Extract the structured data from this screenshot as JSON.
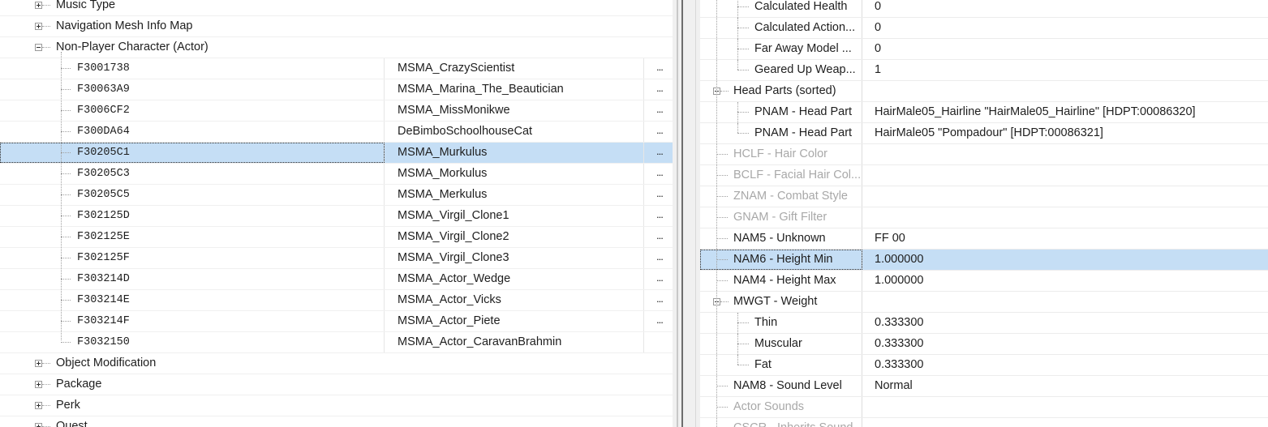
{
  "left_tree": {
    "groups_top": [
      {
        "label": "Music Type",
        "state": "collapsed"
      },
      {
        "label": "Navigation Mesh Info Map",
        "state": "collapsed"
      },
      {
        "label": "Non-Player Character (Actor)",
        "state": "expanded"
      }
    ],
    "npc_rows": [
      {
        "form_id": "F3001738",
        "editor_id": "MSMA_CrazyScientist",
        "more": "..."
      },
      {
        "form_id": "F30063A9",
        "editor_id": "MSMA_Marina_The_Beautician",
        "more": "..."
      },
      {
        "form_id": "F3006CF2",
        "editor_id": "MSMA_MissMonikwe",
        "more": "..."
      },
      {
        "form_id": "F300DA64",
        "editor_id": "DeBimboSchoolhouseCat",
        "more": "..."
      },
      {
        "form_id": "F30205C1",
        "editor_id": "MSMA_Murkulus",
        "more": "...",
        "selected": true
      },
      {
        "form_id": "F30205C3",
        "editor_id": "MSMA_Morkulus",
        "more": "..."
      },
      {
        "form_id": "F30205C5",
        "editor_id": "MSMA_Merkulus",
        "more": "..."
      },
      {
        "form_id": "F302125D",
        "editor_id": "MSMA_Virgil_Clone1",
        "more": "..."
      },
      {
        "form_id": "F302125E",
        "editor_id": "MSMA_Virgil_Clone2",
        "more": "..."
      },
      {
        "form_id": "F302125F",
        "editor_id": "MSMA_Virgil_Clone3",
        "more": "..."
      },
      {
        "form_id": "F303214D",
        "editor_id": "MSMA_Actor_Wedge",
        "more": "..."
      },
      {
        "form_id": "F303214E",
        "editor_id": "MSMA_Actor_Vicks",
        "more": "..."
      },
      {
        "form_id": "F303214F",
        "editor_id": "MSMA_Actor_Piete",
        "more": "..."
      },
      {
        "form_id": "F3032150",
        "editor_id": "MSMA_Actor_CaravanBrahmin",
        "more": ""
      }
    ],
    "groups_bottom": [
      {
        "label": "Object Modification",
        "state": "collapsed"
      },
      {
        "label": "Package",
        "state": "collapsed"
      },
      {
        "label": "Perk",
        "state": "collapsed"
      },
      {
        "label": "Quest",
        "state": "collapsed"
      }
    ]
  },
  "properties": [
    {
      "name": "Calculated Health",
      "value": "0",
      "level": 2
    },
    {
      "name": "Calculated Action...",
      "value": "0",
      "level": 2
    },
    {
      "name": "Far Away Model ...",
      "value": "0",
      "level": 2
    },
    {
      "name": "Geared Up Weap...",
      "value": "1",
      "level": 2,
      "last_child": true
    },
    {
      "name": "Head Parts (sorted)",
      "value": "",
      "level": 1,
      "expander": "minus"
    },
    {
      "name": "PNAM - Head Part",
      "value": "HairMale05_Hairline \"HairMale05_Hairline\" [HDPT:00086320]",
      "level": 2
    },
    {
      "name": "PNAM - Head Part",
      "value": "HairMale05 \"Pompadour\" [HDPT:00086321]",
      "level": 2,
      "last_child": true
    },
    {
      "name": "HCLF - Hair Color",
      "value": "",
      "level": 1,
      "disabled": true
    },
    {
      "name": "BCLF - Facial Hair Col...",
      "value": "",
      "level": 1,
      "disabled": true
    },
    {
      "name": "ZNAM - Combat Style",
      "value": "",
      "level": 1,
      "disabled": true
    },
    {
      "name": "GNAM - Gift Filter",
      "value": "",
      "level": 1,
      "disabled": true
    },
    {
      "name": "NAM5 - Unknown",
      "value": "FF 00",
      "level": 1
    },
    {
      "name": "NAM6 - Height Min",
      "value": "1.000000",
      "level": 1,
      "selected": true
    },
    {
      "name": "NAM4 - Height Max",
      "value": "1.000000",
      "level": 1
    },
    {
      "name": "MWGT - Weight",
      "value": "",
      "level": 1,
      "expander": "minus"
    },
    {
      "name": "Thin",
      "value": "0.333300",
      "level": 2
    },
    {
      "name": "Muscular",
      "value": "0.333300",
      "level": 2
    },
    {
      "name": "Fat",
      "value": "0.333300",
      "level": 2,
      "last_child": true
    },
    {
      "name": "NAM8 - Sound Level",
      "value": "Normal",
      "level": 1
    },
    {
      "name": "Actor Sounds",
      "value": "",
      "level": 1,
      "disabled": true
    },
    {
      "name": "CSCR - Inherits Sound...",
      "value": "",
      "level": 1,
      "disabled": true
    }
  ],
  "colors": {
    "selection": "#c5def5",
    "disabled_text": "#a8a8a8",
    "splitter_dark": "#6d6d6d"
  }
}
